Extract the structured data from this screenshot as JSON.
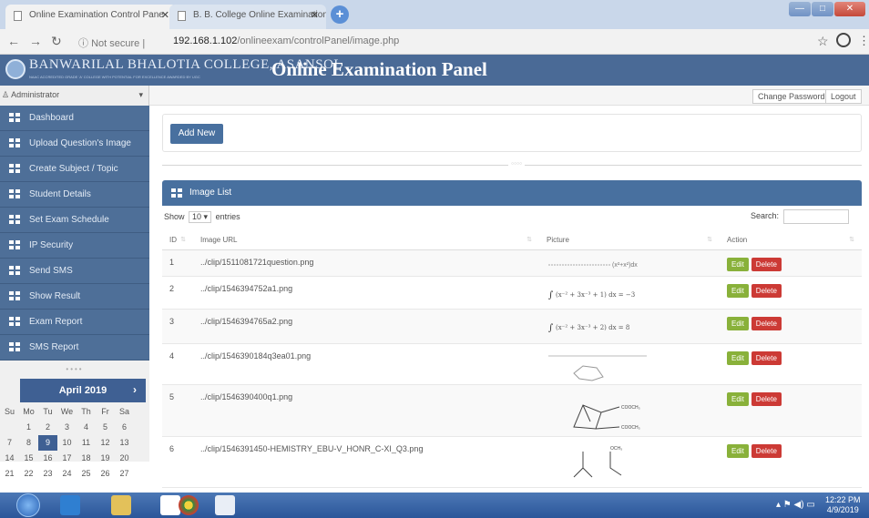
{
  "browser": {
    "tabs": [
      {
        "title": "Online Examination Control Pane",
        "active": true
      },
      {
        "title": "B. B. College Online Examination",
        "active": false
      }
    ],
    "address": {
      "info": "Not secure",
      "host": "192.168.1.102",
      "path": "/onlineexam/controlPanel/image.php"
    }
  },
  "header": {
    "college": "BANWARILAL BHALOTIA COLLEGE, ASANSOL",
    "college_sub": "NAAC ACCREDITED GRADE 'A' COLLEGE WITH POTENTIAL FOR EXCELLENCE AWARDED BY UGC",
    "title": "Online Examination Panel"
  },
  "userbar": {
    "user": "Administrator",
    "change_password": "Change Password",
    "logout": "Logout"
  },
  "sidebar": {
    "items": [
      {
        "label": "Dashboard"
      },
      {
        "label": "Upload Question's Image"
      },
      {
        "label": "Create Subject / Topic"
      },
      {
        "label": "Student Details"
      },
      {
        "label": "Set Exam Schedule"
      },
      {
        "label": "IP Security"
      },
      {
        "label": "Send SMS"
      },
      {
        "label": "Show Result"
      },
      {
        "label": "Exam Report"
      },
      {
        "label": "SMS Report"
      }
    ],
    "dots": "••••"
  },
  "calendar": {
    "month": "April 2019",
    "next": "›",
    "days": [
      "Su",
      "Mo",
      "Tu",
      "We",
      "Th",
      "Fr",
      "Sa"
    ],
    "weeks": [
      [
        "",
        "1",
        "2",
        "3",
        "4",
        "5",
        "6"
      ],
      [
        "7",
        "8",
        "9",
        "10",
        "11",
        "12",
        "13"
      ],
      [
        "14",
        "15",
        "16",
        "17",
        "18",
        "19",
        "20"
      ],
      [
        "21",
        "22",
        "23",
        "24",
        "25",
        "26",
        "27"
      ]
    ],
    "selected": "9"
  },
  "main": {
    "add_button": "Add New",
    "panel_title": "Image List",
    "show_label": "Show",
    "show_value": "10",
    "entries_label": "entries",
    "search_label": "Search:",
    "columns": [
      "ID",
      "Image URL",
      "Picture",
      "Action"
    ],
    "rows": [
      {
        "id": "1",
        "url": "../clip/1511081721question.png"
      },
      {
        "id": "2",
        "url": "../clip/1546394752a1.png"
      },
      {
        "id": "3",
        "url": "../clip/1546394765a2.png"
      },
      {
        "id": "4",
        "url": "../clip/1546390184q3ea01.png"
      },
      {
        "id": "5",
        "url": "../clip/1546390400q1.png"
      },
      {
        "id": "6",
        "url": "../clip/1546391450-HEMISTRY_EBU-V_HONR_C-XI_Q3.png"
      }
    ],
    "edit_label": "Edit",
    "delete_label": "Delete"
  },
  "taskbar": {
    "time": "12:22 PM",
    "date": "4/9/2019"
  },
  "colors": {
    "accent": "#48709f",
    "sidebar": "#4e6f98",
    "edit": "#89b13a",
    "delete": "#cc3a35"
  }
}
